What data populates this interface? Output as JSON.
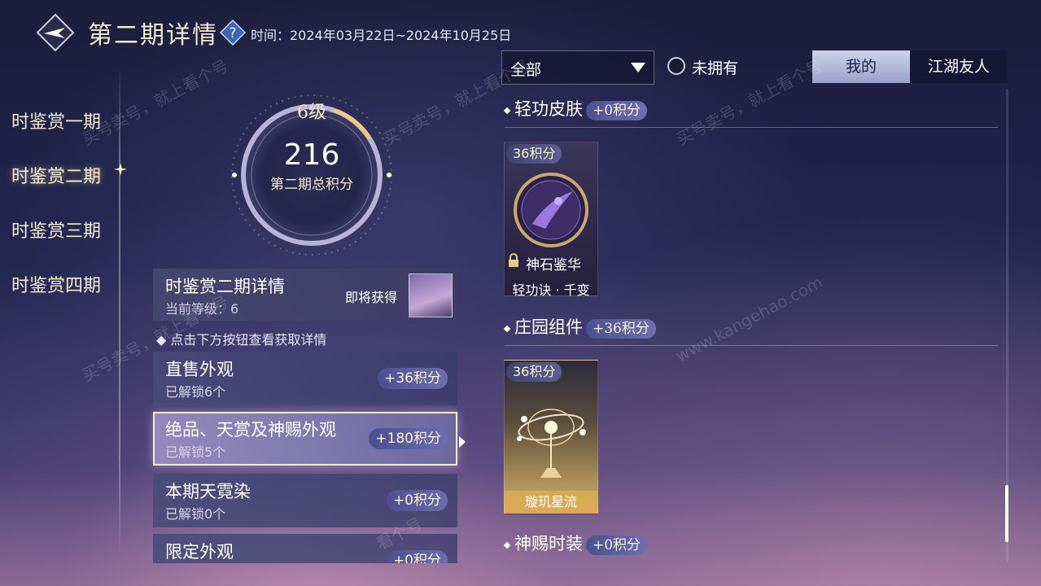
{
  "header": {
    "title": "第二期详情",
    "period": "时间：2024年03月22日~2024年10月25日"
  },
  "left_nav": {
    "items": [
      {
        "label": "时鉴赏一期"
      },
      {
        "label": "时鉴赏二期",
        "active": true
      },
      {
        "label": "时鉴赏三期"
      },
      {
        "label": "时鉴赏四期"
      }
    ]
  },
  "score": {
    "level": "6级",
    "value": "216",
    "label": "第二期总积分",
    "level_progress": 0.1
  },
  "details": {
    "title": "时鉴赏二期详情",
    "current_level": "当前等级：6",
    "upcoming": "即将获得",
    "hint": "点击下方按钮查看获取详情"
  },
  "categories": [
    {
      "title": "直售外观",
      "unlocked": "已解锁6个",
      "points": "+36积分"
    },
    {
      "title": "绝品、天赏及神赐外观",
      "unlocked": "已解锁5个",
      "points": "+180积分",
      "selected": true
    },
    {
      "title": "本期天霓染",
      "unlocked": "已解锁0个",
      "points": "+0积分"
    },
    {
      "title": "限定外观",
      "unlocked": "",
      "points": "+0积分"
    }
  ],
  "filters": {
    "select_value": "全部",
    "radio_label": "未拥有",
    "tabs": [
      "我的",
      "江湖友人"
    ],
    "active_tab": "我的"
  },
  "sections": [
    {
      "title": "轻功皮肤",
      "points": "+0积分",
      "items": [
        {
          "points": "36积分",
          "badge": "神石鉴华",
          "caption": "轻功诀 · 千变",
          "locked": true
        }
      ]
    },
    {
      "title": "庄园组件",
      "points": "+36积分",
      "items": [
        {
          "points": "36积分",
          "caption": "璇玑星流"
        }
      ]
    },
    {
      "title": "神赐时装",
      "points": "+0积分",
      "items": []
    }
  ],
  "watermark": {
    "line1": "买号卖号，就上看个号",
    "line2": "www.kangehao.com",
    "line3": "看个号"
  },
  "colors": {
    "accent_gold": "#f3ead2",
    "points_text": "#fff1c9",
    "pill_bg": "#5a5f9f"
  },
  "icons": {
    "back": "back-arrow-icon",
    "help": "question-mark-icon",
    "lock": "lock-icon",
    "dropdown": "chevron-down-icon"
  }
}
